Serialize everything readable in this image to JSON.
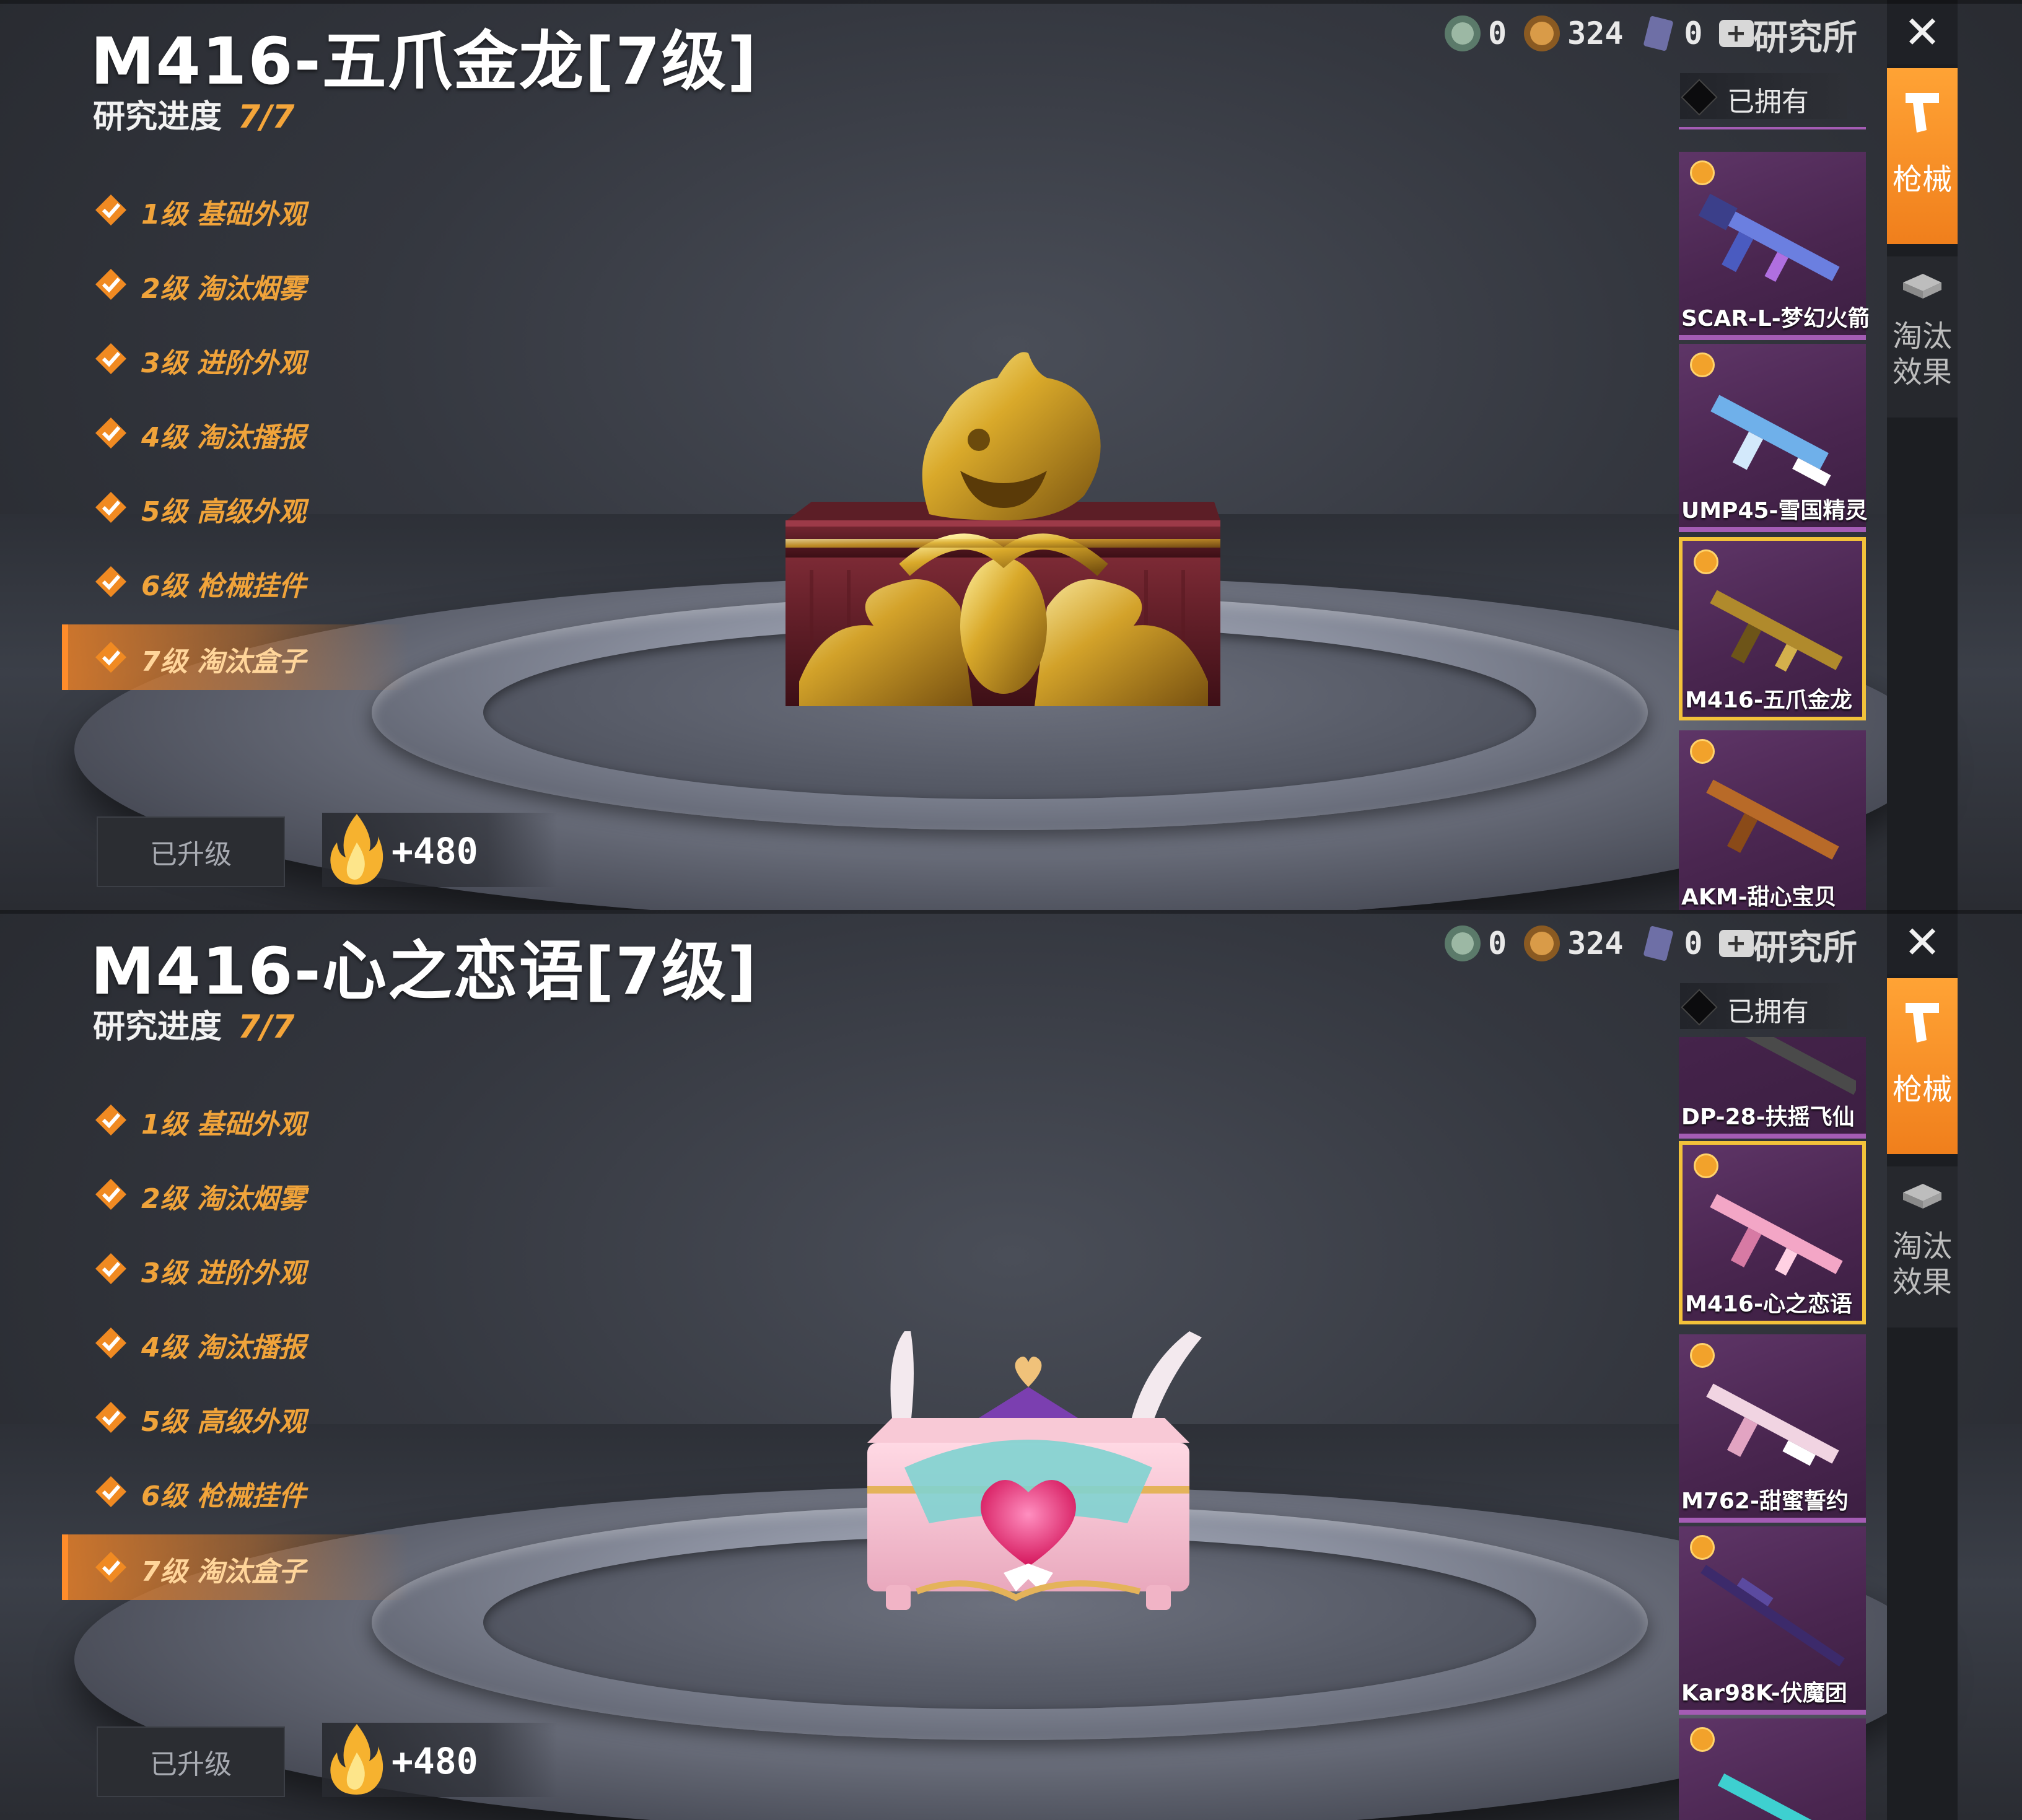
{
  "panels": [
    {
      "title": "M416-五爪金龙[7级]",
      "progress_label": "研究进度",
      "progress_value": "7/7",
      "levels": [
        "1级 基础外观",
        "2级 淘汰烟雾",
        "3级 进阶外观",
        "4级 淘汰播报",
        "5级 高级外观",
        "6级 枪械挂件",
        "7级 淘汰盒子"
      ],
      "active_level_index": 6,
      "upgraded_label": "已升级",
      "reward_amount": "+480",
      "currency": {
        "a": "0",
        "b": "324",
        "c": "0"
      },
      "lab_label": "研究所",
      "close_icon": "✕",
      "owned_label": "已拥有",
      "tabs": {
        "guns": "枪械",
        "effect": "淘汰效果"
      },
      "skins": [
        {
          "name": "SCAR-L-梦幻火箭",
          "selected": false
        },
        {
          "name": "UMP45-雪国精灵",
          "selected": false
        },
        {
          "name": "M416-五爪金龙",
          "selected": true
        },
        {
          "name": "AKM-甜心宝贝",
          "selected": false
        }
      ],
      "display_item": "gold-dragon-crate"
    },
    {
      "title": "M416-心之恋语[7级]",
      "progress_label": "研究进度",
      "progress_value": "7/7",
      "levels": [
        "1级 基础外观",
        "2级 淘汰烟雾",
        "3级 进阶外观",
        "4级 淘汰播报",
        "5级 高级外观",
        "6级 枪械挂件",
        "7级 淘汰盒子"
      ],
      "active_level_index": 6,
      "upgraded_label": "已升级",
      "reward_amount": "+480",
      "currency": {
        "a": "0",
        "b": "324",
        "c": "0"
      },
      "lab_label": "研究所",
      "close_icon": "✕",
      "owned_label": "已拥有",
      "tabs": {
        "guns": "枪械",
        "effect": "淘汰效果"
      },
      "skins": [
        {
          "name": "DP-28-扶摇飞仙",
          "selected": false
        },
        {
          "name": "M416-心之恋语",
          "selected": true
        },
        {
          "name": "M762-甜蜜誓约",
          "selected": false
        },
        {
          "name": "Kar98K-伏魔团",
          "selected": false
        }
      ],
      "display_item": "pink-heart-crate"
    }
  ],
  "colors": {
    "accent_orange": "#f07f1c",
    "level_text": "#f0a33a",
    "selected_border": "#f3c23a",
    "skin_card": "#4a2650"
  },
  "icons": [
    "check-diamond-icon",
    "flame-icon",
    "coin-icon",
    "medal-icon",
    "card-icon",
    "plus-icon",
    "close-icon",
    "pistol-icon",
    "crate-icon",
    "rarity-badge-icon"
  ]
}
